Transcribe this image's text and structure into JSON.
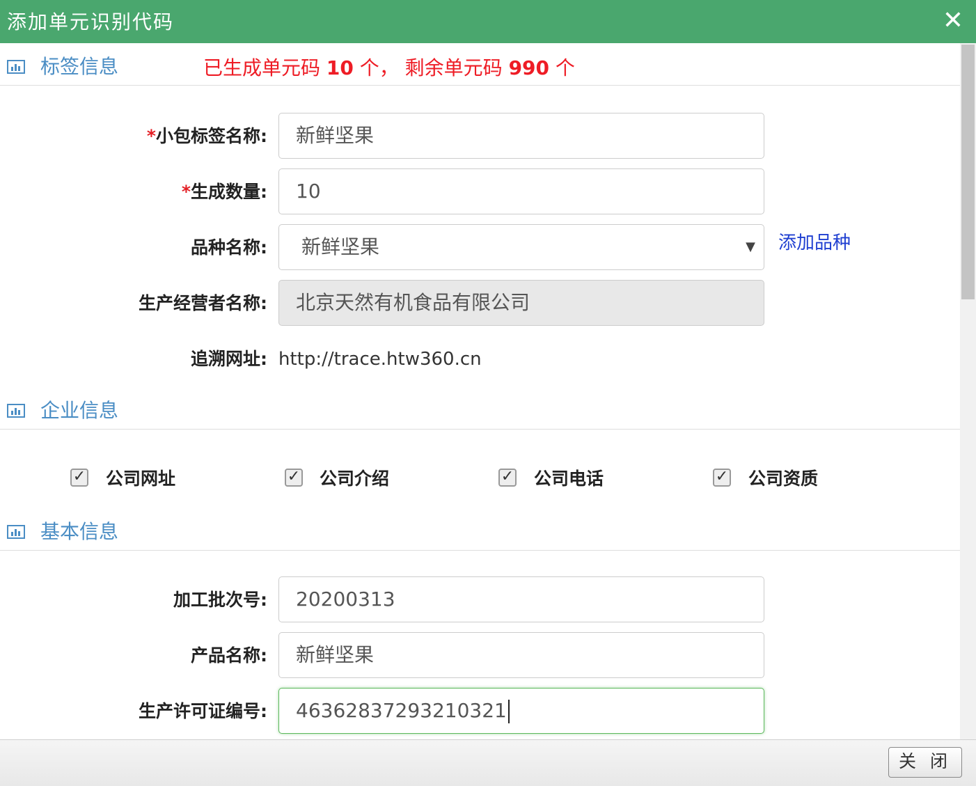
{
  "dialog": {
    "title": "添加单元识别代码",
    "close_glyph": "✕",
    "close_button_label": "关 闭"
  },
  "sections": {
    "label_info": {
      "title": "标签信息",
      "gen_prefix": "已生成单元码 ",
      "generated_count": "10",
      "gen_middle": " 个， 剩余单元码 ",
      "remaining_count": "990",
      "gen_suffix": " 个"
    },
    "company_info": {
      "title": "企业信息"
    },
    "basic_info": {
      "title": "基本信息"
    }
  },
  "form": {
    "package_label_name": {
      "required_mark": "*",
      "label": "小包标签名称:",
      "value": "新鲜坚果"
    },
    "generate_quantity": {
      "required_mark": "*",
      "label": "生成数量:",
      "value": "10"
    },
    "variety_name": {
      "label": "品种名称:",
      "value": "新鲜坚果",
      "add_link": "添加品种"
    },
    "producer_name": {
      "label": "生产经营者名称:",
      "value": "北京天然有机食品有限公司"
    },
    "trace_url": {
      "label": "追溯网址:",
      "value": "http://trace.htw360.cn"
    },
    "batch_number": {
      "label": "加工批次号:",
      "value": "20200313"
    },
    "product_name": {
      "label": "产品名称:",
      "value": "新鲜坚果"
    },
    "license_number": {
      "label": "生产许可证编号:",
      "value": "46362837293210321"
    }
  },
  "company_options": [
    {
      "label": "公司网址",
      "checked": true
    },
    {
      "label": "公司介绍",
      "checked": true
    },
    {
      "label": "公司电话",
      "checked": true
    },
    {
      "label": "公司资质",
      "checked": true
    }
  ],
  "icons": {
    "section": "bar-chart-icon",
    "checkbox": "check-mark-icon",
    "select": "dropdown-arrow-icon"
  },
  "colors": {
    "titlebar": "#4aa76e",
    "section_title": "#4a8dc4",
    "alert_text": "#ee1c25",
    "link": "#1f3fd1",
    "focus_border": "#5cb85c"
  }
}
